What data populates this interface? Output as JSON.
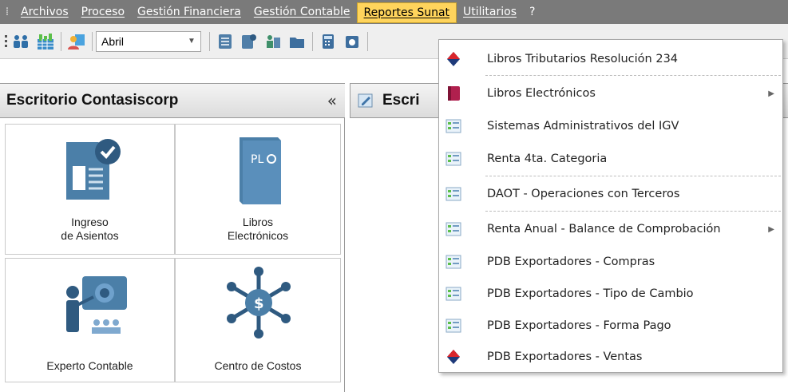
{
  "menubar": {
    "items": [
      {
        "label": "Archivos"
      },
      {
        "label": "Proceso"
      },
      {
        "label": "Gestión Financiera"
      },
      {
        "label": "Gestión Contable"
      },
      {
        "label": "Reportes Sunat",
        "active": true
      },
      {
        "label": "Utilitarios"
      },
      {
        "label": "?"
      }
    ]
  },
  "toolbar": {
    "month_value": "Abril"
  },
  "left_panel": {
    "title": "Escritorio Contasiscorp",
    "collapse": "«",
    "tiles": [
      {
        "line1": "Ingreso",
        "line2": "de Asientos"
      },
      {
        "line1": "Libros",
        "line2": "Electrónicos"
      },
      {
        "line1": "Experto Contable",
        "line2": ""
      },
      {
        "line1": "Centro de Costos",
        "line2": ""
      }
    ]
  },
  "right_panel": {
    "title": "Escri"
  },
  "dropdown": {
    "items": [
      {
        "label": "Libros Tributarios Resolución 234",
        "icon": "diamond-logo-icon",
        "submenu": false
      },
      {
        "label": "Libros Electrónicos",
        "icon": "book-icon",
        "submenu": true
      },
      {
        "label": "Sistemas Administrativos del IGV",
        "icon": "form-icon",
        "submenu": false
      },
      {
        "label": "Renta 4ta. Categoria",
        "icon": "form-icon",
        "submenu": false
      },
      {
        "label": "DAOT - Operaciones con Terceros",
        "icon": "form-icon",
        "submenu": false
      },
      {
        "label": "Renta Anual - Balance de Comprobación",
        "icon": "form-icon",
        "submenu": true
      },
      {
        "label": "PDB Exportadores - Compras",
        "icon": "form-icon",
        "submenu": false
      },
      {
        "label": "PDB Exportadores - Tipo de Cambio",
        "icon": "form-icon",
        "submenu": false
      },
      {
        "label": "PDB Exportadores - Forma Pago",
        "icon": "form-icon",
        "submenu": false
      },
      {
        "label": "PDB Exportadores - Ventas",
        "icon": "diamond-logo-icon",
        "submenu": false
      }
    ]
  },
  "colors": {
    "menubar_bg": "#7a7a7a",
    "active_menu": "#ffd45c",
    "tile_icon_blue": "#4b7fa8"
  }
}
